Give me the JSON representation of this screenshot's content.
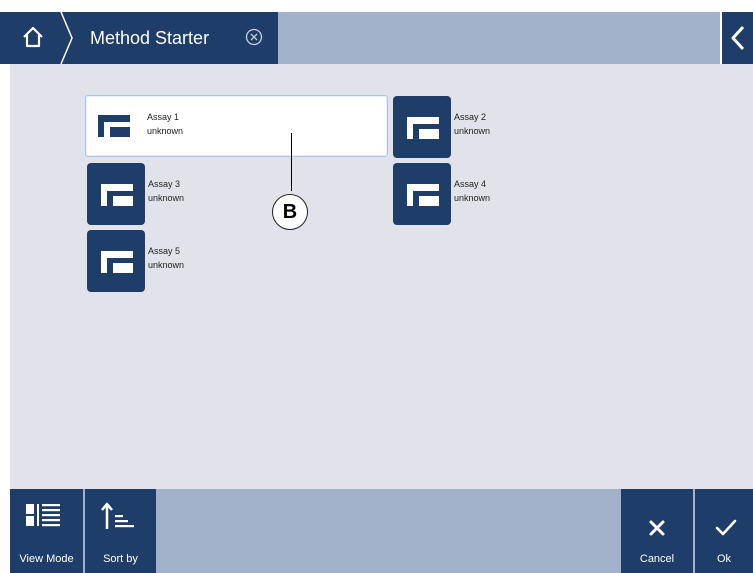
{
  "header": {
    "home_icon": "home-icon",
    "title": "Method Starter",
    "close_icon": "close-circle-icon",
    "back_icon": "chevron-left-icon"
  },
  "methods": [
    {
      "name": "Assay 1",
      "status": "unknown",
      "selected": true
    },
    {
      "name": "Assay 2",
      "status": "unknown",
      "selected": false
    },
    {
      "name": "Assay 3",
      "status": "unknown",
      "selected": false
    },
    {
      "name": "Assay 4",
      "status": "unknown",
      "selected": false
    },
    {
      "name": "Assay 5",
      "status": "unknown",
      "selected": false
    }
  ],
  "callout": {
    "label": "B"
  },
  "footer": {
    "view_mode_label": "View Mode",
    "sort_by_label": "Sort by",
    "cancel_label": "Cancel",
    "ok_label": "Ok"
  },
  "colors": {
    "primary": "#1e3d69",
    "bar_background": "#a2b2ca",
    "content_background": "#e2e3ea",
    "selected_border": "#a9c4e6"
  }
}
